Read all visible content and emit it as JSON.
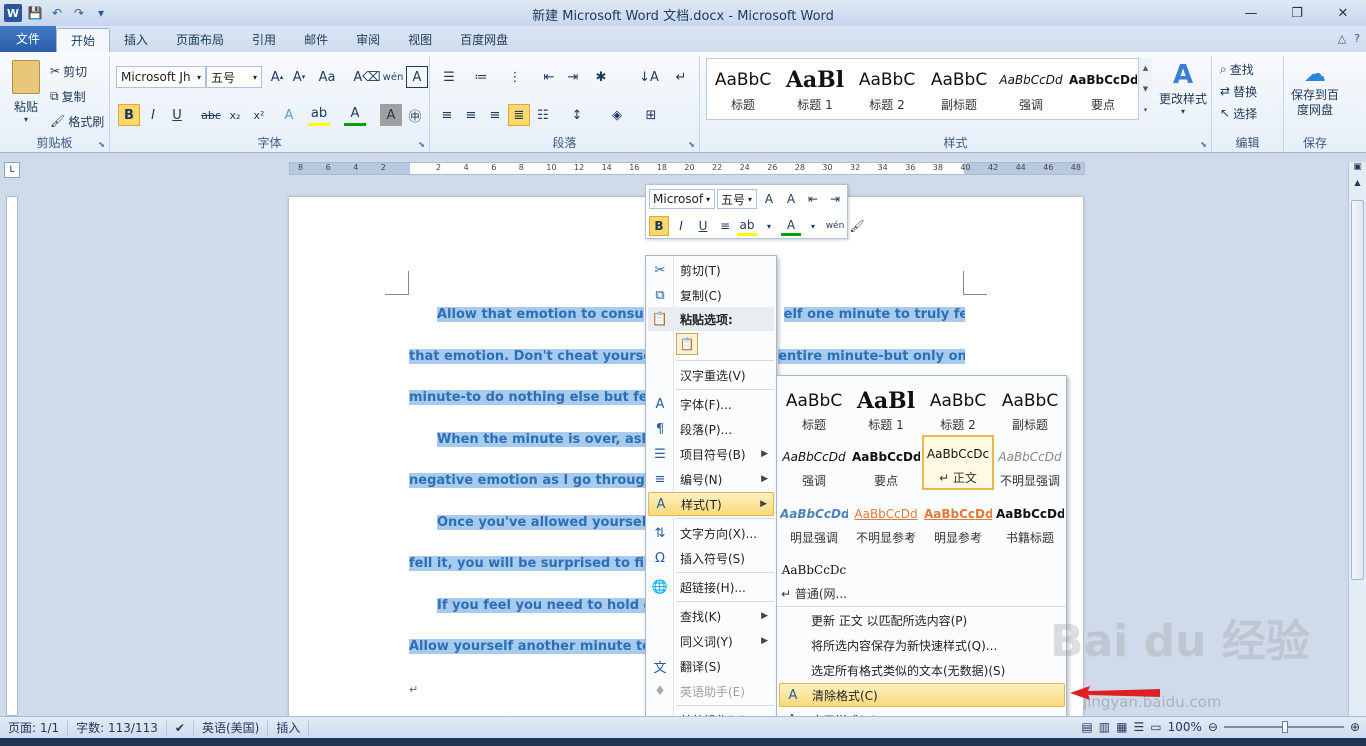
{
  "window": {
    "title": "新建 Microsoft Word 文档.docx  -  Microsoft Word",
    "controls": [
      "minimize",
      "restore",
      "close"
    ]
  },
  "tabs": [
    {
      "label": "文件",
      "kind": "file"
    },
    {
      "label": "开始",
      "kind": "active"
    },
    {
      "label": "插入"
    },
    {
      "label": "页面布局"
    },
    {
      "label": "引用"
    },
    {
      "label": "邮件"
    },
    {
      "label": "审阅"
    },
    {
      "label": "视图"
    },
    {
      "label": "百度网盘"
    }
  ],
  "ribbon": {
    "clipboard": {
      "label": "剪贴板",
      "paste": "粘贴",
      "cut": "剪切",
      "copy": "复制",
      "format_painter": "格式刷"
    },
    "font": {
      "label": "字体",
      "font_name": "Microsoft Jh",
      "font_size": "五号"
    },
    "paragraph": {
      "label": "段落"
    },
    "styles": {
      "label": "样式",
      "items": [
        {
          "sample": "AaBbC",
          "name": "标题"
        },
        {
          "sample": "AaBl",
          "name": "标题 1"
        },
        {
          "sample": "AaBbC",
          "name": "标题 2"
        },
        {
          "sample": "AaBbC",
          "name": "副标题"
        },
        {
          "sample": "AaBbCcDd",
          "name": "强调"
        },
        {
          "sample": "AaBbCcDd",
          "name": "要点"
        }
      ],
      "change_styles": "更改样式"
    },
    "editing": {
      "label": "编辑",
      "find": "查找",
      "replace": "替换",
      "select": "选择"
    },
    "save": {
      "label": "保存",
      "save_baidu": "保存到百度网盘"
    }
  },
  "ruler_numbers": [
    "8",
    "6",
    "4",
    "2",
    "",
    "2",
    "4",
    "6",
    "8",
    "10",
    "12",
    "14",
    "16",
    "18",
    "20",
    "22",
    "24",
    "26",
    "28",
    "30",
    "32",
    "34",
    "36",
    "38",
    "40",
    "42",
    "44",
    "46",
    "48"
  ],
  "document": {
    "lines": [
      {
        "text": "Allow that emotion to consu",
        "tail": "elf one minute to truly feel",
        "indent": true
      },
      {
        "text": "that emotion. Don't cheat yourse",
        "tail": "entire minute-but only one",
        "indent": false
      },
      {
        "text": "minute-to do nothing else but feel",
        "tail": "",
        "indent": false
      },
      {
        "text": "When the minute is over, ask y",
        "tail": "",
        "indent": true
      },
      {
        "text": "negative emotion as I go through t",
        "tail": "",
        "indent": false
      },
      {
        "text": "Once you've allowed yourself t",
        "tail": "",
        "indent": true
      },
      {
        "text": "fell it, you will be surprised to find t",
        "tail": "",
        "indent": false
      },
      {
        "text": "If you feel you need to hold o",
        "tail": "",
        "indent": true
      },
      {
        "text": "Allow yourself another minute to fe",
        "tail": "",
        "indent": false
      }
    ],
    "paragraph_mark": "↵"
  },
  "mini_toolbar": {
    "font_name": "Microsof",
    "font_size": "五号"
  },
  "context_menu": {
    "items": [
      {
        "label": "剪切(T)",
        "icon": "✂"
      },
      {
        "label": "复制(C)",
        "icon": "⧉"
      },
      {
        "label": "粘贴选项:",
        "icon": "📋",
        "kind": "head"
      },
      {
        "label": "汉字重选(V)",
        "icon": ""
      },
      {
        "label": "字体(F)...",
        "icon": "A"
      },
      {
        "label": "段落(P)...",
        "icon": "¶"
      },
      {
        "label": "项目符号(B)",
        "icon": "☰",
        "arrow": true
      },
      {
        "label": "编号(N)",
        "icon": "≡",
        "arrow": true
      },
      {
        "label": "样式(T)",
        "icon": "A",
        "arrow": true,
        "kind": "hl"
      },
      {
        "label": "文字方向(X)...",
        "icon": "⇅"
      },
      {
        "label": "插入符号(S)",
        "icon": "Ω"
      },
      {
        "label": "超链接(H)...",
        "icon": "🌐"
      },
      {
        "label": "查找(K)",
        "icon": "",
        "arrow": true
      },
      {
        "label": "同义词(Y)",
        "icon": "",
        "arrow": true
      },
      {
        "label": "翻译(S)",
        "icon": "文"
      },
      {
        "label": "英语助手(E)",
        "icon": "♦",
        "kind": "disabled"
      },
      {
        "label": "其他操作(A)",
        "icon": "",
        "arrow": true
      }
    ]
  },
  "styles_submenu": {
    "gallery": [
      {
        "sample": "AaBbC",
        "name": "标题"
      },
      {
        "sample": "AaBl",
        "name": "标题 1"
      },
      {
        "sample": "AaBbC",
        "name": "标题 2"
      },
      {
        "sample": "AaBbC",
        "name": "副标题"
      },
      {
        "sample": "AaBbCcDd",
        "name": "强调"
      },
      {
        "sample": "AaBbCcDd",
        "name": "要点"
      },
      {
        "sample": "AaBbCcDc",
        "name": "↵ 正文",
        "selected": true
      },
      {
        "sample": "AaBbCcDd",
        "name": "不明显强调"
      },
      {
        "sample": "AaBbCcDd",
        "name": "明显强调"
      },
      {
        "sample": "AaBbCcDd",
        "name": "不明显参考"
      },
      {
        "sample": "AaBbCcDd",
        "name": "明显参考"
      },
      {
        "sample": "AaBbCcDd",
        "name": "书籍标题"
      },
      {
        "sample": "AaBbCcDc",
        "name": "↵ 普通(网..."
      }
    ],
    "commands": [
      {
        "label": "更新 正文 以匹配所选内容(P)",
        "icon": ""
      },
      {
        "label": "将所选内容保存为新快速样式(Q)...",
        "icon": ""
      },
      {
        "label": "选定所有格式类似的文本(无数据)(S)",
        "icon": ""
      },
      {
        "label": "清除格式(C)",
        "icon": "A",
        "highlighted": true
      },
      {
        "label": "应用样式(A)...",
        "icon": "A"
      }
    ]
  },
  "status": {
    "page": "页面: 1/1",
    "words": "字数: 113/113",
    "language": "英语(美国)",
    "mode": "插入",
    "zoom": "100%"
  },
  "watermark": {
    "main": "Bai du 经验",
    "sub": "jingyan.baidu.com"
  },
  "colors": {
    "selection": "#a7cbee",
    "text": "#2e6fb3",
    "highlight": "#fbd97a"
  }
}
